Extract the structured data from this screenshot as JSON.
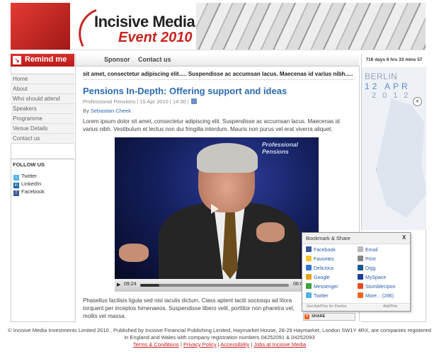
{
  "header": {
    "logo_title": "Incisive Media",
    "logo_event": "Event 2010"
  },
  "remind": {
    "label": "Remind me"
  },
  "nav": {
    "items": [
      "Home",
      "About",
      "Who should attend",
      "Speakers",
      "Programme",
      "Venue Details",
      "Contact us"
    ]
  },
  "follow": {
    "title": "FOLLOW US",
    "items": [
      {
        "label": "Twitter",
        "icon": "twitter-icon",
        "color": "#4fb3e8"
      },
      {
        "label": "LinkedIn",
        "icon": "linkedin-icon",
        "color": "#1b6aa5"
      },
      {
        "label": "Facebook",
        "icon": "facebook-icon",
        "color": "#3b5998"
      }
    ]
  },
  "topnav": {
    "sponsor": "Sponsor",
    "contact": "Contact us"
  },
  "ticker": "sit amet, consectetur adipiscing elit.....   Suspendisse ac accumsan lacus. Maecenas id varius nibh.....   Vestibulu",
  "article": {
    "title": "Pensions In-Depth: Offering support and ideas",
    "meta": "Professional Pensions | 15 Apr 2010 | 14:30 |",
    "by_prefix": "By",
    "author": "Sebastian Cheek",
    "para1": "Lorem ipsum dolor sit amet, consectetur adipiscing elit. Suspendisse ac accumsan lacus. Maecenas id varius nibh. Vestibulum et lectus non dui fringilla interdum. Mauris non purus vel erat viverra aliquet.",
    "para2": "Phasellus facilisis ligula sed nisi iaculis dictum. Class aptent taciti sociosqu ad litora torquent per inceptos himenaeos. Suspendisse libero velit, porttitor non pharetra vel, mollis vel massa."
  },
  "video": {
    "watermark": "Professional Pensions",
    "time_current": "09:24",
    "time_total": "06:06",
    "progress": 0.13
  },
  "countdown": "716 days 6 hrs 33 mins 57 sec",
  "map": {
    "city": "BERLIN",
    "date": "12 APR",
    "year": "2012"
  },
  "bookmark": {
    "title": "Bookmark & Share",
    "close": "X",
    "items": [
      {
        "label": "Facebook",
        "color": "#3b5998"
      },
      {
        "label": "Email",
        "color": "#bbbbbb"
      },
      {
        "label": "Favorites",
        "color": "#f2c230"
      },
      {
        "label": "Print",
        "color": "#888888"
      },
      {
        "label": "Delicious",
        "color": "#3274d1"
      },
      {
        "label": "Digg",
        "color": "#1b5891"
      },
      {
        "label": "Google",
        "color": "#e8a317"
      },
      {
        "label": "MySpace",
        "color": "#1c3f94"
      },
      {
        "label": "Messenger",
        "color": "#3ca23c"
      },
      {
        "label": "StumbleUpon",
        "color": "#eb4924"
      },
      {
        "label": "Twitter",
        "color": "#4fb3e8"
      },
      {
        "label": "More... (286)",
        "color": "#f26522"
      }
    ],
    "footer_left": "Get AddThis for Firefox",
    "footer_right": "AddThis"
  },
  "share_button": "SHARE",
  "footer": {
    "line1": "© Incisive Media Investments Limited 2010 , Published by Incisive Financial Publishing Limited, Haymarket House, 28-29 Haymarket, London SW1Y 4RX, are companies registered in England and Wales with company registration numbers 04252091 & 04252093",
    "links": [
      "Terms & Conditions",
      "Privacy Policy",
      "Accessibility",
      "Jobs at Incisive Media"
    ]
  }
}
